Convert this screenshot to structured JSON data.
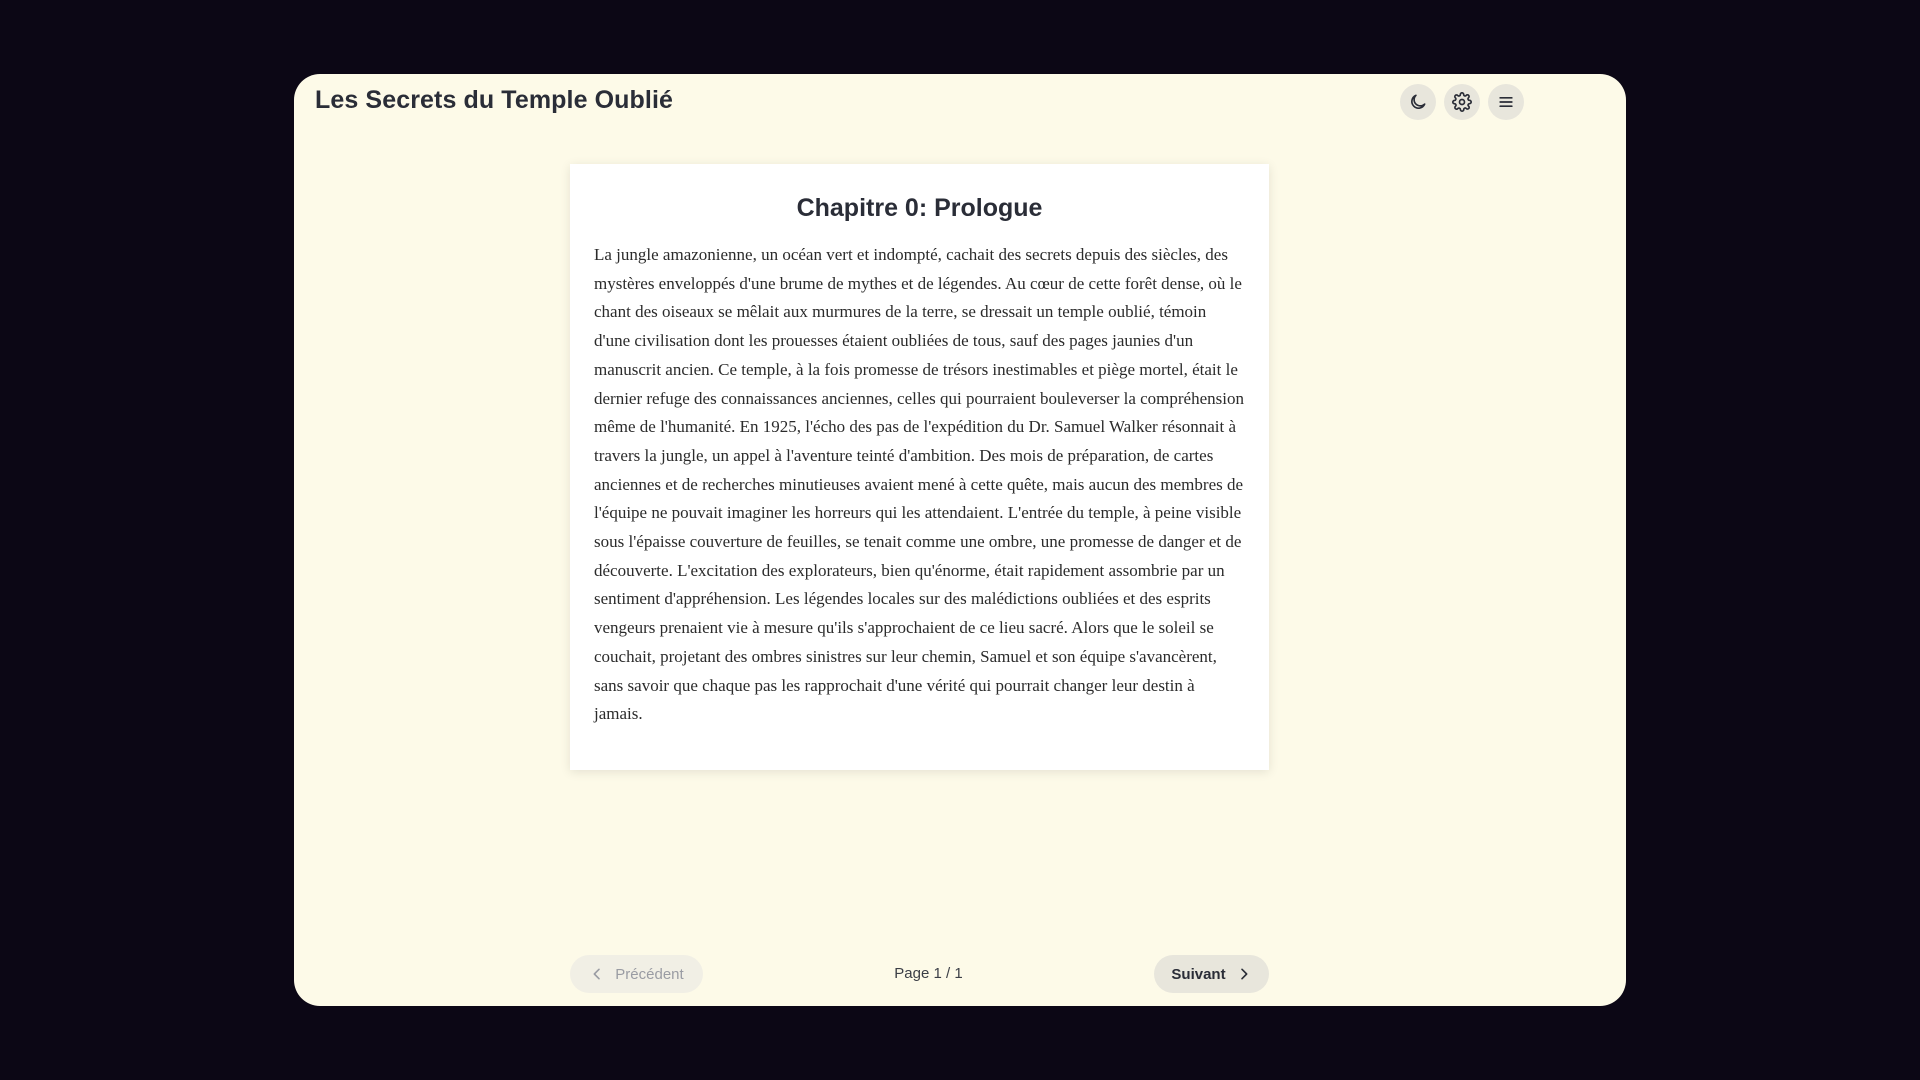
{
  "app": {
    "title": "Les Secrets du Temple Oublié"
  },
  "toolbar": {
    "buttons": [
      {
        "name": "theme-toggle",
        "icon": "moon-icon"
      },
      {
        "name": "settings",
        "icon": "gear-icon"
      },
      {
        "name": "menu",
        "icon": "hamburger-menu-icon"
      }
    ]
  },
  "chapter": {
    "title": "Chapitre 0: Prologue",
    "text": "La jungle amazonienne, un océan vert et indompté, cachait des secrets depuis des siècles, des mystères enveloppés d'une brume de mythes et de légendes. Au cœur de cette forêt dense, où le chant des oiseaux se mêlait aux murmures de la terre, se dressait un temple oublié, témoin d'une civilisation dont les prouesses étaient oubliées de tous, sauf des pages jaunies d'un manuscrit ancien. Ce temple, à la fois promesse de trésors inestimables et piège mortel, était le dernier refuge des connaissances anciennes, celles qui pourraient bouleverser la compréhension même de l'humanité. En 1925, l'écho des pas de l'expédition du Dr. Samuel Walker résonnait à travers la jungle, un appel à l'aventure teinté d'ambition. Des mois de préparation, de cartes anciennes et de recherches minutieuses avaient mené à cette quête, mais aucun des membres de l'équipe ne pouvait imaginer les horreurs qui les attendaient. L'entrée du temple, à peine visible sous l'épaisse couverture de feuilles, se tenait comme une ombre, une promesse de danger et de découverte. L'excitation des explorateurs, bien qu'énorme, était rapidement assombrie par un sentiment d'appréhension. Les légendes locales sur des malédictions oubliées et des esprits vengeurs prenaient vie à mesure qu'ils s'approchaient de ce lieu sacré. Alors que le soleil se couchait, projetant des ombres sinistres sur leur chemin, Samuel et son équipe s'avancèrent, sans savoir que chaque pas les rapprochait d'une vérité qui pourrait changer leur destin à jamais."
  },
  "pagination": {
    "prev_label": "Précédent",
    "next_label": "Suivant",
    "page_label": "Page 1 / 1",
    "prev_disabled": true
  },
  "colors": {
    "backdrop": "#0c0715",
    "window": "#fdfae8",
    "card": "#ffffff",
    "text": "#2a2d37"
  }
}
